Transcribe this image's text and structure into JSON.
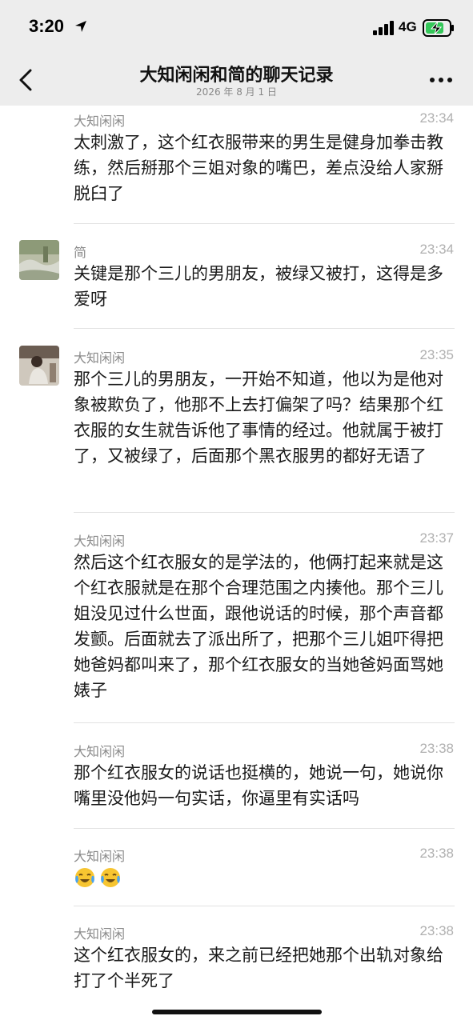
{
  "status": {
    "time": "3:20",
    "network": "4G"
  },
  "nav": {
    "title": "大知闲闲和简的聊天记录",
    "subtitle": "2026 年 8 月 1 日"
  },
  "messages": [
    {
      "sender": "大知闲闲",
      "time": "23:34",
      "text": "太刺激了，这个红衣服带来的男生是健身加拳击教练，然后掰那个三姐对象的嘴巴，差点没给人家掰脱臼了"
    },
    {
      "sender": "简",
      "time": "23:34",
      "text": "关键是那个三儿的男朋友，被绿又被打，这得是多爱呀"
    },
    {
      "sender": "大知闲闲",
      "time": "23:35",
      "text": "那个三儿的男朋友，一开始不知道，他以为是他对象被欺负了，他那不上去打偏架了吗？结果那个红衣服的女生就告诉他了事情的经过。他就属于被打了，又被绿了，后面那个黑衣服男的都好无语了"
    },
    {
      "sender": "大知闲闲",
      "time": "23:37",
      "text": "然后这个红衣服女的是学法的，他俩打起来就是这个红衣服就是在那个合理范围之内揍他。那个三儿姐没见过什么世面，跟他说话的时候，那个声音都发颤。后面就去了派出所了，把那个三儿姐吓得把她爸妈都叫来了，那个红衣服女的当她爸妈面骂她婊子"
    },
    {
      "sender": "大知闲闲",
      "time": "23:38",
      "text": "那个红衣服女的说话也挺横的，她说一句，她说你嘴里没他妈一句实话，你逼里有实话吗"
    },
    {
      "sender": "大知闲闲",
      "time": "23:38",
      "emojis": [
        "crying-laughing-face-icon",
        "crying-laughing-face-icon"
      ]
    },
    {
      "sender": "大知闲闲",
      "time": "23:38",
      "text": "这个红衣服女的，来之前已经把她那个出轨对象给打了个半死了"
    }
  ]
}
